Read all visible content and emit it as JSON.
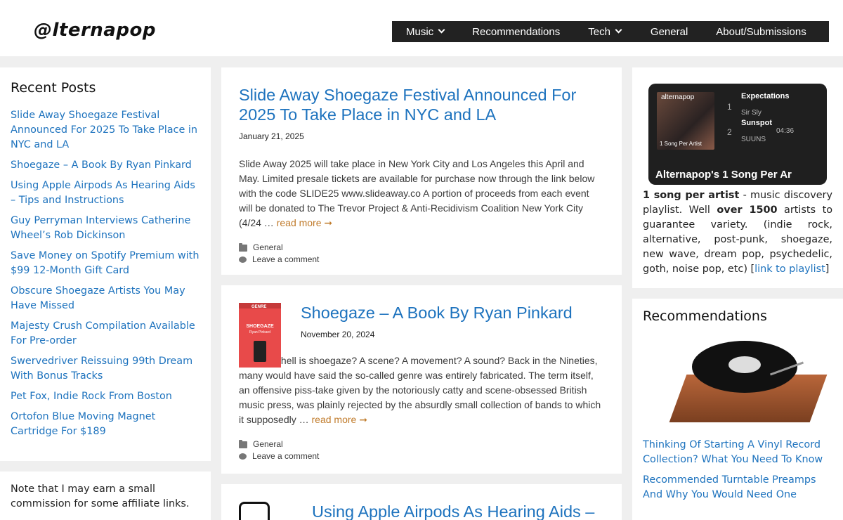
{
  "header": {
    "logo": "@lternapop",
    "nav": [
      {
        "label": "Music",
        "has_dropdown": true
      },
      {
        "label": "Recommendations",
        "has_dropdown": false
      },
      {
        "label": "Tech",
        "has_dropdown": true
      },
      {
        "label": "General",
        "has_dropdown": false
      },
      {
        "label": "About/Submissions",
        "has_dropdown": false
      }
    ]
  },
  "left_sidebar": {
    "recent_title": "Recent Posts",
    "recent_posts": [
      "Slide Away Shoegaze Festival Announced For 2025 To Take Place in NYC and LA",
      "Shoegaze – A Book By Ryan Pinkard",
      "Using Apple Airpods As Hearing Aids – Tips and Instructions",
      "Guy Perryman Interviews Catherine Wheel’s Rob Dickinson",
      "Save Money on Spotify Premium with $99 12-Month Gift Card",
      "Obscure Shoegaze Artists You May Have Missed",
      "Majesty Crush Compilation Available For Pre-order",
      "Swervedriver Reissuing 99th Dream With Bonus Tracks",
      "Pet Fox, Indie Rock From Boston",
      "Ortofon Blue Moving Magnet Cartridge For $189"
    ],
    "affiliate_note": "Note that I may earn a small commission for some affiliate links."
  },
  "articles": [
    {
      "title": "Slide Away Shoegaze Festival Announced For 2025 To Take Place in NYC and LA",
      "date": "January 21, 2025",
      "excerpt": "Slide Away 2025 will take place in New York City and Los Angeles this April and May. Limited presale tickets are available for purchase now through the link below with the code SLIDE25 www.slideaway.co A portion of proceeds from each event will be donated to The Trevor Project & Anti-Recidivism Coalition New York City (4/24 …",
      "read_more": "read more ➞",
      "category": "General",
      "comment": "Leave a comment"
    },
    {
      "title": "Shoegaze – A Book By Ryan Pinkard",
      "date": "November 20, 2024",
      "excerpt": "What the hell is shoegaze? A scene? A movement? A sound? Back in the Nineties, many would have said the so-called genre was entirely fabricated. The term itself, an offensive piss-take given by the notoriously catty and scene-obsessed British music press, was plainly rejected by the absurdly small collection of bands to which it supposedly …",
      "read_more": "read more ➞",
      "category": "General",
      "comment": "Leave a comment",
      "thumb": {
        "genre": "GENRE",
        "title": "SHOEGAZE",
        "author": "Ryan Pinkard"
      }
    },
    {
      "title": "Using Apple Airpods As Hearing Aids –"
    }
  ],
  "right_sidebar": {
    "playlist": {
      "brand": "alternapop",
      "cover_label": "1 Song Per Artist",
      "tracks": [
        {
          "num": "1",
          "title": "Expectations",
          "artist": "Sir Sly"
        },
        {
          "num": "2",
          "title": "Sunspot",
          "artist": "SUUNS",
          "duration": "04:36"
        }
      ],
      "name": "Alternapop's 1 Song Per Ar"
    },
    "desc_bold1": "1 song per artist",
    "desc_part1": " - music discovery playlist. Well ",
    "desc_bold2": "over 1500",
    "desc_part2": " artists to guarantee variety. (indie rock, alternative, post-punk, shoegaze, new wave, dream pop, psychedelic, goth, noise pop, etc) [",
    "desc_link": "link to playlist",
    "desc_end": "]",
    "rec_title": "Recommendations",
    "rec_posts": [
      "Thinking Of Starting A Vinyl Record Collection? What You Need To Know",
      "Recommended Turntable Preamps And Why You Would Need One"
    ]
  }
}
